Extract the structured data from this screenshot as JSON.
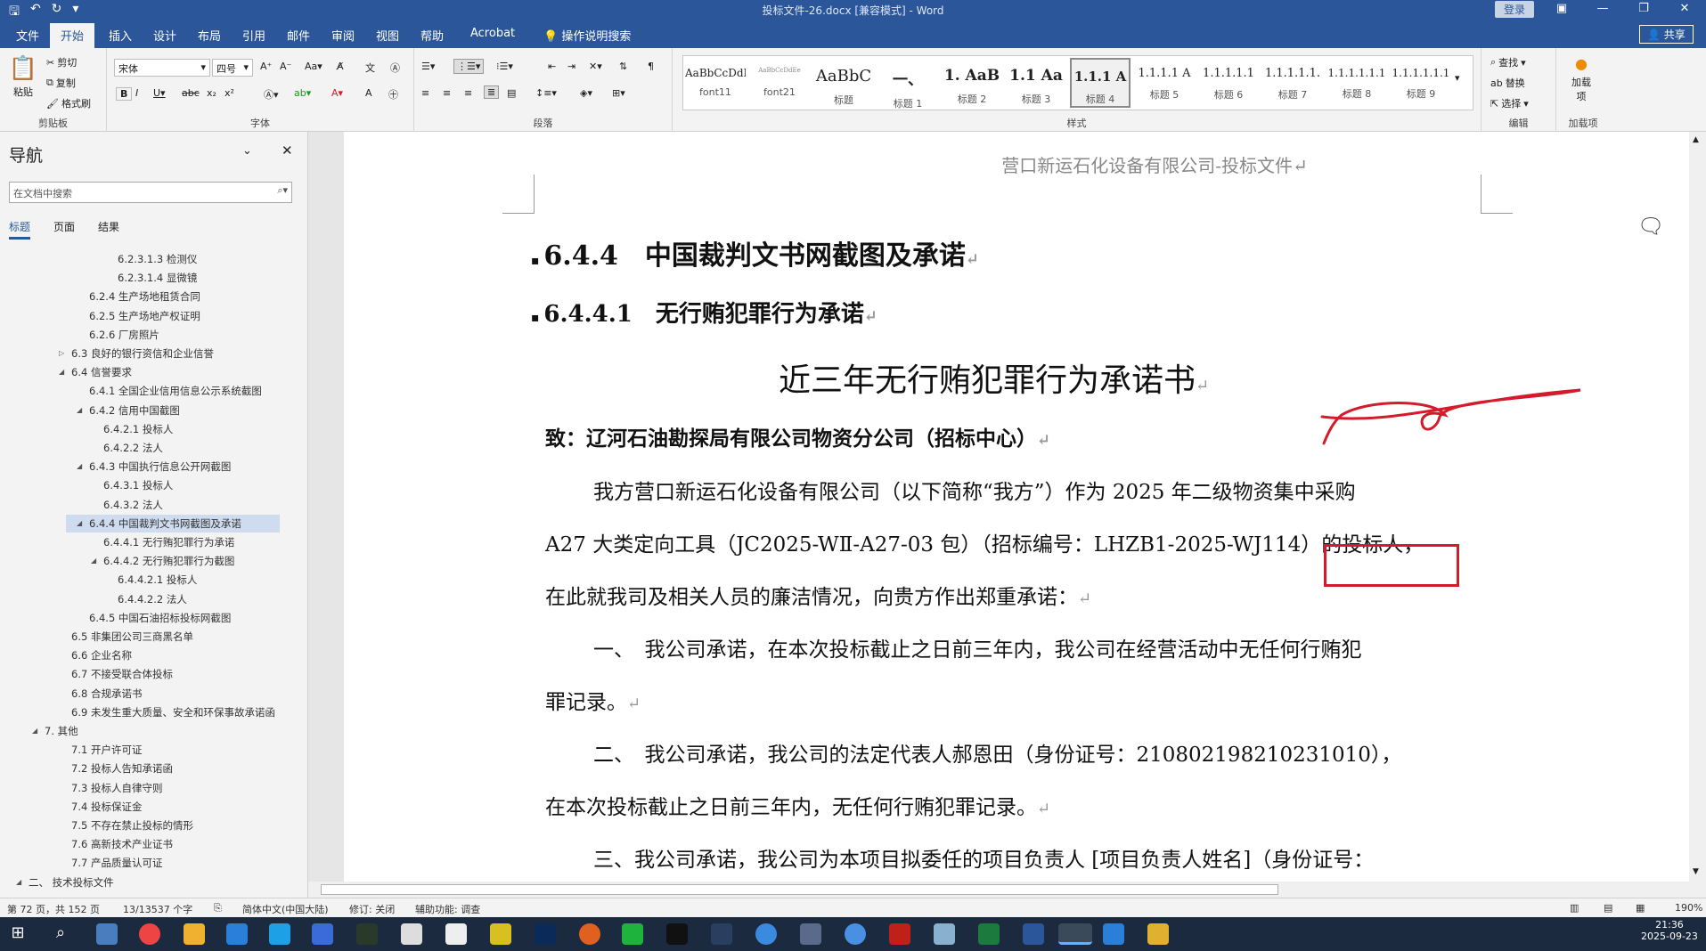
{
  "app": {
    "doc_title": "投标文件-26.docx [兼容模式] - Word",
    "login": "登录",
    "share": "共享"
  },
  "tabs": [
    "文件",
    "开始",
    "插入",
    "设计",
    "布局",
    "引用",
    "邮件",
    "审阅",
    "视图",
    "帮助",
    "Acrobat",
    "操作说明搜索"
  ],
  "ribbon": {
    "clipboard": {
      "paste": "粘贴",
      "cut": "剪切",
      "copy": "复制",
      "format_painter": "格式刷",
      "label": "剪贴板"
    },
    "font": {
      "family": "宋体",
      "size": "四号",
      "label": "字体"
    },
    "paragraph": {
      "label": "段落"
    },
    "styles": {
      "label": "样式",
      "items": [
        {
          "preview": "AaBbCcDdI",
          "name": "font11"
        },
        {
          "preview": "AaBbCcDdEe",
          "name": "font21"
        },
        {
          "preview": "AaBbC",
          "name": "标题"
        },
        {
          "preview": "一、",
          "name": "标题 1"
        },
        {
          "preview": "1. AaB",
          "name": "标题 2"
        },
        {
          "preview": "1.1 Aa",
          "name": "标题 3"
        },
        {
          "preview": "1.1.1 A",
          "name": "标题 4"
        },
        {
          "preview": "1.1.1.1 A",
          "name": "标题 5"
        },
        {
          "preview": "1.1.1.1.1",
          "name": "标题 6"
        },
        {
          "preview": "1.1.1.1.1.",
          "name": "标题 7"
        },
        {
          "preview": "1.1.1.1.1.1",
          "name": "标题 8"
        },
        {
          "preview": "1.1.1.1.1.1",
          "name": "标题 9"
        }
      ]
    },
    "editing": {
      "find": "查找",
      "replace": "替换",
      "select": "选择",
      "label": "编辑"
    },
    "addins": {
      "load": "加载项",
      "label": "加载项"
    }
  },
  "nav": {
    "title": "导航",
    "search_placeholder": "在文档中搜索",
    "tabs": [
      "标题",
      "页面",
      "结果"
    ],
    "items": [
      {
        "text": "6.2.3.1.3 检测仪",
        "lvl": 5
      },
      {
        "text": "6.2.3.1.4 显微镜",
        "lvl": 5
      },
      {
        "text": "6.2.4 生产场地租赁合同",
        "lvl": 3
      },
      {
        "text": "6.2.5 生产场地产权证明",
        "lvl": 3
      },
      {
        "text": "6.2.6 厂房照片",
        "lvl": 3
      },
      {
        "text": "6.3 良好的银行资信和企业信誉",
        "lvl": 2,
        "tw": "▷"
      },
      {
        "text": "6.4 信誉要求",
        "lvl": 2,
        "tw": "◢"
      },
      {
        "text": "6.4.1 全国企业信用信息公示系统截图",
        "lvl": 3
      },
      {
        "text": "6.4.2 信用中国截图",
        "lvl": 3,
        "tw": "◢"
      },
      {
        "text": "6.4.2.1 投标人",
        "lvl": 4
      },
      {
        "text": "6.4.2.2 法人",
        "lvl": 4
      },
      {
        "text": "6.4.3 中国执行信息公开网截图",
        "lvl": 3,
        "tw": "◢"
      },
      {
        "text": "6.4.3.1 投标人",
        "lvl": 4
      },
      {
        "text": "6.4.3.2 法人",
        "lvl": 4
      },
      {
        "text": "6.4.4 中国裁判文书网截图及承诺",
        "lvl": 3,
        "tw": "◢",
        "sel": true
      },
      {
        "text": "6.4.4.1 无行贿犯罪行为承诺",
        "lvl": 4
      },
      {
        "text": "6.4.4.2 无行贿犯罪行为截图",
        "lvl": 4,
        "tw": "◢"
      },
      {
        "text": "6.4.4.2.1 投标人",
        "lvl": 5
      },
      {
        "text": "6.4.4.2.2 法人",
        "lvl": 5
      },
      {
        "text": "6.4.5 中国石油招标投标网截图",
        "lvl": 3
      },
      {
        "text": "6.5 非集团公司三商黑名单",
        "lvl": 2
      },
      {
        "text": "6.6 企业名称",
        "lvl": 2
      },
      {
        "text": "6.7 不接受联合体投标",
        "lvl": 2
      },
      {
        "text": "6.8 合规承诺书",
        "lvl": 2
      },
      {
        "text": "6.9 未发生重大质量、安全和环保事故承诺函",
        "lvl": 2
      },
      {
        "text": "7. 其他",
        "lvl": 1,
        "tw": "◢"
      },
      {
        "text": "7.1 开户许可证",
        "lvl": 2
      },
      {
        "text": "7.2 投标人告知承诺函",
        "lvl": 2
      },
      {
        "text": "7.3 投标人自律守则",
        "lvl": 2
      },
      {
        "text": "7.4 投标保证金",
        "lvl": 2
      },
      {
        "text": "7.5 不存在禁止投标的情形",
        "lvl": 2
      },
      {
        "text": "7.6 高新技术产业证书",
        "lvl": 2
      },
      {
        "text": "7.7 产品质量认可证",
        "lvl": 2
      },
      {
        "text": "二、 技术投标文件",
        "lvl": 0,
        "tw": "◢"
      }
    ]
  },
  "doc": {
    "header": "营口新运石化设备有限公司-投标文件↵",
    "h1": "6.4.4　中国裁判文书网截图及承诺",
    "h2": "6.4.4.1　无行贿犯罪行为承诺",
    "title": "近三年无行贿犯罪行为承诺书",
    "to_prefix": "致：辽河石油勘探局有限公司物资分公司",
    "to_boxed": "（招标中心）",
    "lines": [
      "我方营口新运石化设备有限公司（以下简称“我方”）作为 2025 年二级物资集中采购",
      "A27 大类定向工具（JC2025-WⅡ-A27-03 包）（招标编号：LHZB1-2025-WJ114）的投标人，",
      "在此就我司及相关人员的廉洁情况，向贵方作出郑重承诺：",
      "一、　我公司承诺，在本次投标截止之日前三年内，我公司在经营活动中无任何行贿犯",
      "罪记录。",
      "二、　我公司承诺，我公司的法定代表人郝恩田（身份证号：210802198210231010），",
      "在本次投标截止之日前三年内，无任何行贿犯罪记录。",
      "三、我公司承诺，我公司为本项目拟委任的项目负责人 [项目负责人姓名]（身份证号："
    ]
  },
  "status": {
    "page": "第 72 页，共 152 页",
    "words": "13/13537 个字",
    "lang": "简体中文(中国大陆)",
    "track": "修订: 关闭",
    "access": "辅助功能: 调查",
    "zoom": "190%"
  },
  "clock": {
    "time": "21:36",
    "date": "2025-09-23"
  },
  "colors": {
    "accent": "#2b579a",
    "annotation": "#d41b2c"
  }
}
